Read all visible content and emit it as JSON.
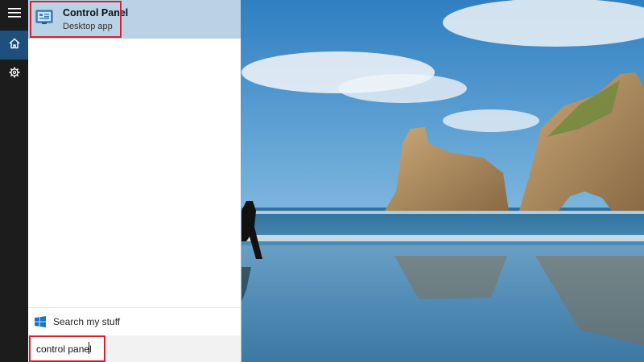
{
  "result": {
    "title": "Control Panel",
    "subtitle": "Desktop app"
  },
  "search_my_stuff": {
    "label": "Search my stuff"
  },
  "search_box": {
    "value": "control panel"
  },
  "icons": {
    "menu": "hamburger-menu-icon",
    "home": "home-icon",
    "settings": "gear-icon",
    "control_panel": "control-panel-icon",
    "windows": "windows-logo-icon"
  },
  "colors": {
    "rail": "#1c1c1c",
    "rail_selected": "#1f4f7c",
    "result_highlight": "#b9d2e6",
    "annotation": "#d9202a"
  }
}
